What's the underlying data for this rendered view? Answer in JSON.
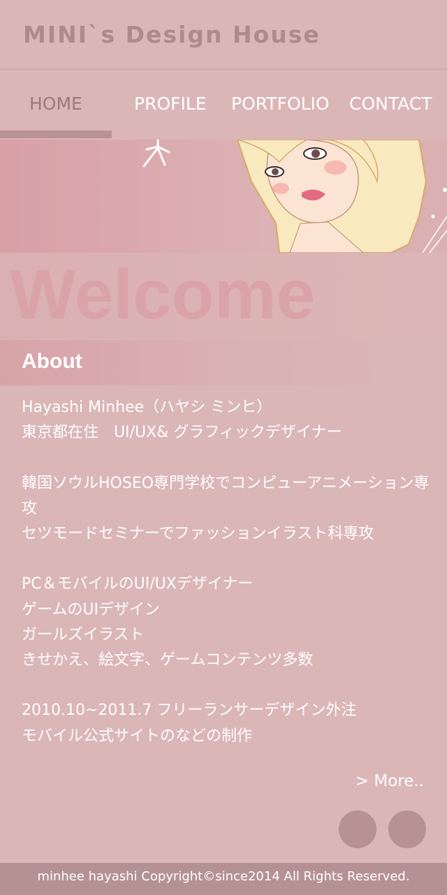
{
  "header": {
    "site_title": "MINI`s Design House"
  },
  "nav": {
    "items": [
      {
        "label": "HOME",
        "active": true
      },
      {
        "label": "PROFILE",
        "active": false
      },
      {
        "label": "PORTFOLIO",
        "active": false
      },
      {
        "label": "CONTACT",
        "active": false
      }
    ]
  },
  "hero": {
    "image": "girl-illustration-banner"
  },
  "welcome": {
    "text": "Welcome"
  },
  "about": {
    "title": "About",
    "lines": [
      "Hayashi Minhee（ハヤシ ミンヒ）",
      "東京都在住　UI/UX& グラフィックデザイナー",
      "韓国ソウルHOSEO専門学校でコンピューアニメーション専攻",
      "セツモードセミナーでファッションイラスト科専攻",
      "PC＆モバイルのUI/UXデザイナー",
      "ゲームのUIデザイン",
      "ガールズイラスト",
      "きせかえ、絵文字、ゲームコンテンツ多数",
      "2010.10~2011.7 フリーランサーデザイン外注",
      "モバイル公式サイトのなどの制作"
    ],
    "more_label": "> More.."
  },
  "colors": {
    "background": "#dbb6b6",
    "accent": "#b79193",
    "footer": "#b49293"
  },
  "footer": {
    "copyright": "minhee hayashi Copyright©since2014 All Rights Reserved."
  }
}
